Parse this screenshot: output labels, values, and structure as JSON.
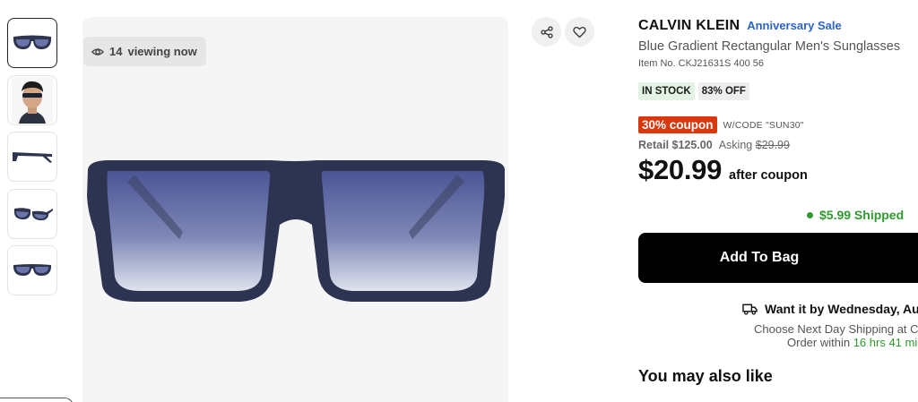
{
  "gallery": {
    "thumbnails": [
      "sunglasses-front",
      "model-wearing",
      "sunglasses-side",
      "sunglasses-angle",
      "sunglasses-front-small"
    ],
    "viewing_count": "14",
    "viewing_text": "viewing now"
  },
  "actions": {
    "share_icon": "share-icon",
    "favorite_icon": "heart-icon"
  },
  "product": {
    "brand": "CALVIN KLEIN",
    "sale_label": "Anniversary Sale",
    "name": "Blue Gradient Rectangular Men's Sunglasses",
    "item_no": "Item No. CKJ21631S 400 56",
    "stock_badge": "IN STOCK",
    "discount_badge": "83% OFF",
    "coupon_label": "30% coupon",
    "coupon_code": "W/CODE \"SUN30\"",
    "retail": "Retail $125.00",
    "asking_label": "Asking",
    "asking_value": "$29.99",
    "price": "$20.99",
    "after_coupon": "after coupon",
    "shipping": "$5.99 Shipped",
    "add_to_bag": "Add To Bag"
  },
  "delivery": {
    "headline": "Want it by Wednesday, Au",
    "next_day": "Choose Next Day Shipping at Ch",
    "order_within_label": "Order within",
    "order_within_time": "16 hrs 41 min"
  },
  "recommendations": {
    "title": "You may also like"
  },
  "colors": {
    "accent_blue": "#2a63c9",
    "coupon_red": "#d9380c",
    "ship_green": "#2e9a2e",
    "button_black": "#000000"
  }
}
